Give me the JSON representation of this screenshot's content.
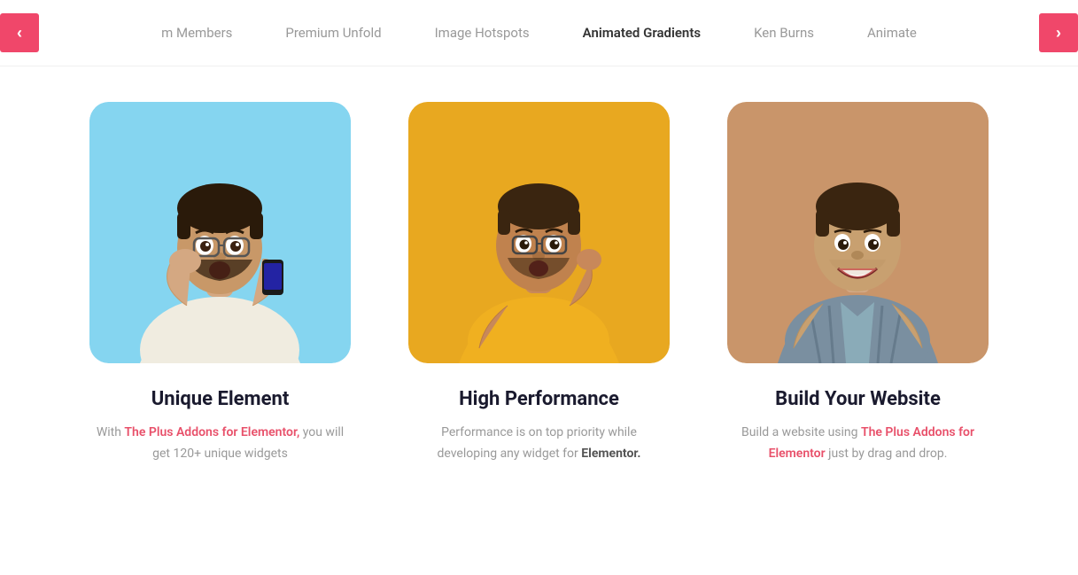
{
  "nav": {
    "items": [
      {
        "label": "m Members",
        "active": false
      },
      {
        "label": "Premium Unfold",
        "active": false
      },
      {
        "label": "Image Hotspots",
        "active": false
      },
      {
        "label": "Animated Gradients",
        "active": true
      },
      {
        "label": "Ken Burns",
        "active": false
      },
      {
        "label": "Animate",
        "active": false
      }
    ],
    "prev_label": "‹",
    "next_label": "›"
  },
  "cards": [
    {
      "title": "Unique Element",
      "desc_parts": [
        {
          "text": "With ",
          "style": "normal"
        },
        {
          "text": "The Plus Addons for Elementor,",
          "style": "highlight"
        },
        {
          "text": " you will get 120+ unique widgets",
          "style": "normal"
        }
      ],
      "bg": "blue",
      "person_color": "#e8c9a0",
      "shirt_color": "#f5f0e8"
    },
    {
      "title": "High Performance",
      "desc_parts": [
        {
          "text": "Performance is on top priority while developing any widget for ",
          "style": "normal"
        },
        {
          "text": "Elementor.",
          "style": "bold"
        }
      ],
      "bg": "yellow",
      "person_color": "#d4a060",
      "shirt_color": "#f0b020"
    },
    {
      "title": "Build Your Website",
      "desc_parts": [
        {
          "text": "Build a website using ",
          "style": "normal"
        },
        {
          "text": "The Plus Addons for Elementor",
          "style": "highlight"
        },
        {
          "text": " just by drag and drop.",
          "style": "normal"
        }
      ],
      "bg": "tan",
      "person_color": "#c8a080",
      "shirt_color": "#8899aa"
    }
  ],
  "colors": {
    "accent": "#f0476a",
    "nav_active": "#333333",
    "nav_inactive": "#999999",
    "card_title": "#1a1a2e",
    "card_desc": "#999999",
    "highlight_red": "#e8506a"
  }
}
